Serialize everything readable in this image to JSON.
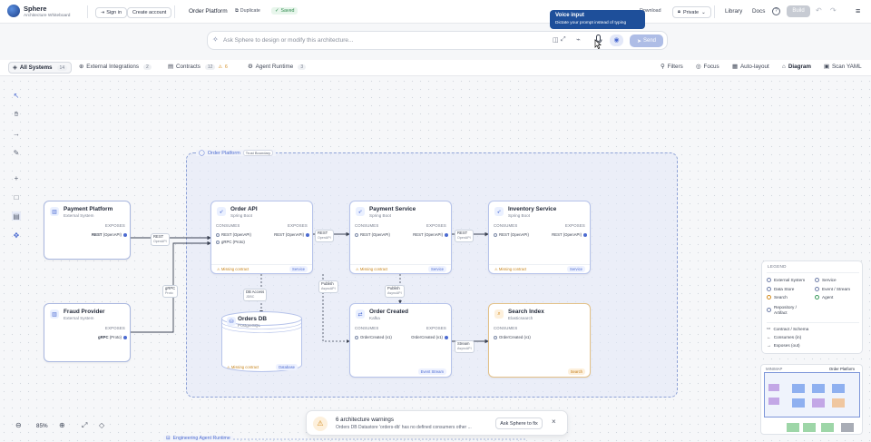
{
  "app": {
    "name": "Sphere",
    "subtitle": "Architecture Whiteboard"
  },
  "header": {
    "sign_in": "Sign in",
    "create_account": "Create account",
    "project": "Order Platform",
    "duplicate": "Duplicate",
    "saved": "Saved",
    "download": "Download",
    "visibility": "Private",
    "library": "Library",
    "docs": "Docs",
    "build": "Build"
  },
  "tooltip": {
    "title": "Voice input",
    "text": "Dictate your prompt instead of typing"
  },
  "prompt": {
    "placeholder": "Ask Sphere to design or modify this architecture...",
    "send": "Send"
  },
  "tabs": [
    {
      "label": "All Systems",
      "count": "14"
    },
    {
      "label": "External Integrations",
      "count": "2"
    },
    {
      "label": "Contracts",
      "count": "12",
      "warn": "6"
    },
    {
      "label": "Agent Runtime",
      "count": "3"
    }
  ],
  "view": {
    "filters": "Filters",
    "focus": "Focus",
    "auto_layout": "Auto-layout",
    "diagram": "Diagram",
    "scan_yaml": "Scan YAML"
  },
  "boundary": {
    "title": "Order Platform",
    "badge": "Trust Boundary"
  },
  "labels": {
    "consumes": "CONSUMES",
    "exposes": "EXPOSES"
  },
  "nodes": {
    "payment_platform": {
      "title": "Payment Platform",
      "sub": "External System",
      "exposes": [
        "REST",
        "(OpenAPI)"
      ]
    },
    "fraud_provider": {
      "title": "Fraud Provider",
      "sub": "External System",
      "exposes": [
        "gRPC",
        "(Proto)"
      ]
    },
    "order_api": {
      "title": "Order API",
      "sub": "Spring Boot",
      "consumes": [
        "REST (OpenAPI)",
        "gRPC (Proto)"
      ],
      "exposes": "REST (OpenAPI)",
      "warn": "Missing contract",
      "type": "Service"
    },
    "payment_service": {
      "title": "Payment Service",
      "sub": "Spring Boot",
      "consumes": "REST (OpenAPI)",
      "exposes": "REST (OpenAPI)",
      "warn": "Missing contract",
      "type": "Service"
    },
    "inventory_service": {
      "title": "Inventory Service",
      "sub": "Spring Boot",
      "consumes": "REST (OpenAPI)",
      "exposes": "REST (OpenAPI)",
      "warn": "Missing contract",
      "type": "Service"
    },
    "orders_db": {
      "title": "Orders DB",
      "sub": "PostgreSQL",
      "warn": "Missing contract",
      "type": "Database"
    },
    "order_created": {
      "title": "Order Created",
      "sub": "Kafka",
      "consumes": "OrderCreated (v1)",
      "exposes": "OrderCreated (v1)",
      "type": "Event Stream"
    },
    "search_index": {
      "title": "Search Index",
      "sub": "Elasticsearch",
      "consumes": "OrderCreated (v1)",
      "type": "Search"
    }
  },
  "edges": {
    "rest1": [
      "REST",
      "OpenAPI"
    ],
    "grpc": [
      "gRPC",
      "Proto"
    ],
    "rest2": [
      "REST",
      "OpenAPI"
    ],
    "rest3": [
      "REST",
      "OpenAPI"
    ],
    "db": [
      "DB Access",
      "JDBC"
    ],
    "pub1": [
      "Publish",
      "AsyncAPI"
    ],
    "pub2": [
      "Publish",
      "AsyncAPI"
    ],
    "stream": [
      "Stream",
      "AsyncAPI"
    ]
  },
  "legend": {
    "title": "LEGEND",
    "items": [
      "External System",
      "Service",
      "Data Store",
      "Event / Stream",
      "Search",
      "Agent",
      "Repository / Artifact"
    ],
    "lines": [
      "Contract / Schema",
      "Consumes (in)",
      "Exposes (out)"
    ]
  },
  "minimap": {
    "title": "MINIMAP",
    "current": "Order Platform"
  },
  "zoom": {
    "level": "85%"
  },
  "warnings": {
    "title": "6 architecture warnings",
    "text": "Orders DB Datastore 'orders-db' has no defined consumers other ...",
    "action": "Ask Sphere to fix"
  },
  "bottom_group": "Engineering Agent Runtime",
  "colors": {
    "accent": "#4c6bd1",
    "warning": "#d38a1c",
    "tooltip": "#1e4f9a"
  }
}
